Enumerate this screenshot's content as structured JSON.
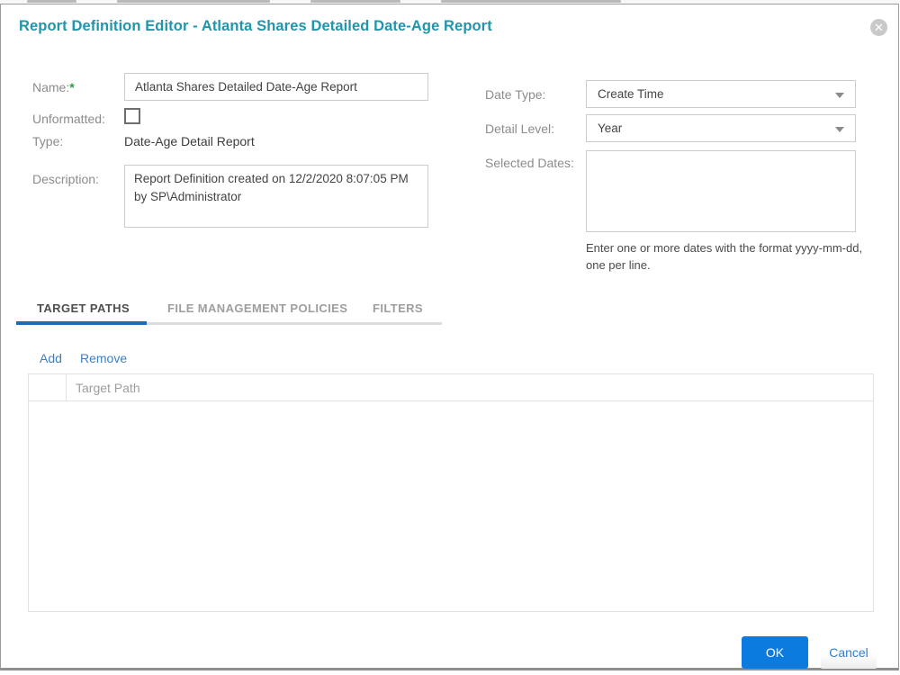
{
  "dialog": {
    "title": "Report Definition Editor - Atlanta Shares Detailed Date-Age Report",
    "close_glyph": "✕"
  },
  "form": {
    "name": {
      "label": "Name:",
      "required_marker": "*",
      "value": "Atlanta Shares Detailed Date-Age Report"
    },
    "unformatted": {
      "label": "Unformatted:",
      "checked": false
    },
    "type": {
      "label": "Type:",
      "value": "Date-Age Detail Report"
    },
    "description": {
      "label": "Description:",
      "value": "Report Definition created on 12/2/2020 8:07:05 PM by SP\\Administrator"
    },
    "date_type": {
      "label": "Date Type:",
      "value": "Create Time"
    },
    "detail_level": {
      "label": "Detail Level:",
      "value": "Year"
    },
    "selected_dates": {
      "label": "Selected Dates:",
      "value": "",
      "hint": "Enter one or more dates with the format yyyy-mm-dd, one per line."
    }
  },
  "tabs": {
    "target_paths": "TARGET PATHS",
    "file_management_policies": "FILE MANAGEMENT POLICIES",
    "filters": "FILTERS"
  },
  "target_paths_panel": {
    "add": "Add",
    "remove": "Remove",
    "column_header": "Target Path",
    "rows": []
  },
  "footer": {
    "ok": "OK",
    "cancel": "Cancel"
  },
  "colors": {
    "title_teal": "#2095ab",
    "active_tab_underline": "#1c6bbf",
    "ok_button_blue": "#0c7be0",
    "link_blue": "#3d7fc4",
    "required_green": "#27a042"
  }
}
